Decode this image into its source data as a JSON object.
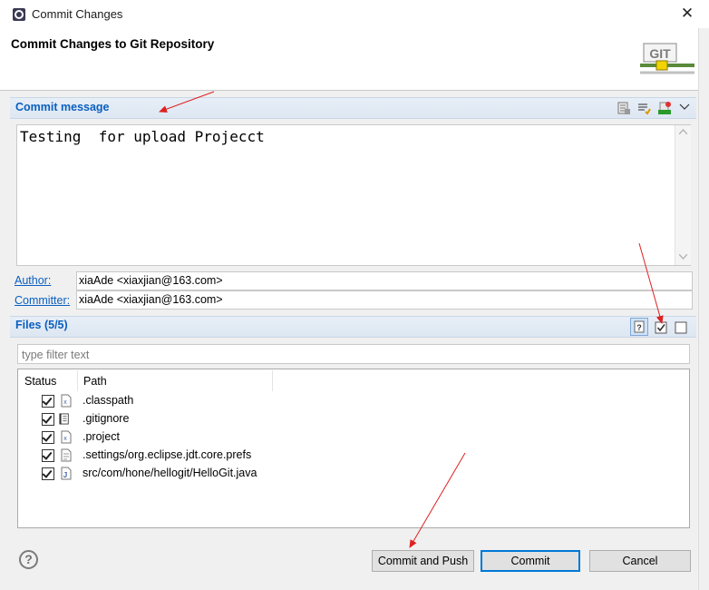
{
  "window": {
    "title": "Commit Changes",
    "close_glyph": "✕"
  },
  "banner": {
    "title": "Commit Changes to Git Repository",
    "logo_text": "GIT"
  },
  "commit_message": {
    "section_title": "Commit message",
    "text": "Testing  for upload Projecct",
    "toolbar_icons": [
      "compare-icon",
      "spell-check-icon",
      "sign-off-icon",
      "menu-dropdown-icon"
    ]
  },
  "author": {
    "label": "Author:",
    "value": "xiaAde <xiaxjian@163.com>"
  },
  "committer": {
    "label": "Committer:",
    "value": "xiaAde <xiaxjian@163.com>"
  },
  "files": {
    "section_title": "Files (5/5)",
    "filter_placeholder": "type filter text",
    "columns": [
      "Status",
      "Path"
    ],
    "rows": [
      {
        "checked": true,
        "icon": "xml-file-icon",
        "path": ".classpath"
      },
      {
        "checked": true,
        "icon": "text-file-icon",
        "path": ".gitignore"
      },
      {
        "checked": true,
        "icon": "xml-file-icon",
        "path": ".project"
      },
      {
        "checked": true,
        "icon": "prefs-file-icon",
        "path": ".settings/org.eclipse.jdt.core.prefs"
      },
      {
        "checked": true,
        "icon": "java-file-icon",
        "path": "src/com/hone/hellogit/HelloGit.java"
      }
    ],
    "toolbar_icons": [
      "show-untracked-icon",
      "select-all-icon",
      "deselect-all-icon"
    ]
  },
  "buttons": {
    "help": "?",
    "commit_and_push": "Commit and Push",
    "commit": "Commit",
    "cancel": "Cancel"
  },
  "colors": {
    "accent": "#0a5fbf",
    "annotation_arrow": "#e02020",
    "section_bar": "#dde7f2"
  }
}
